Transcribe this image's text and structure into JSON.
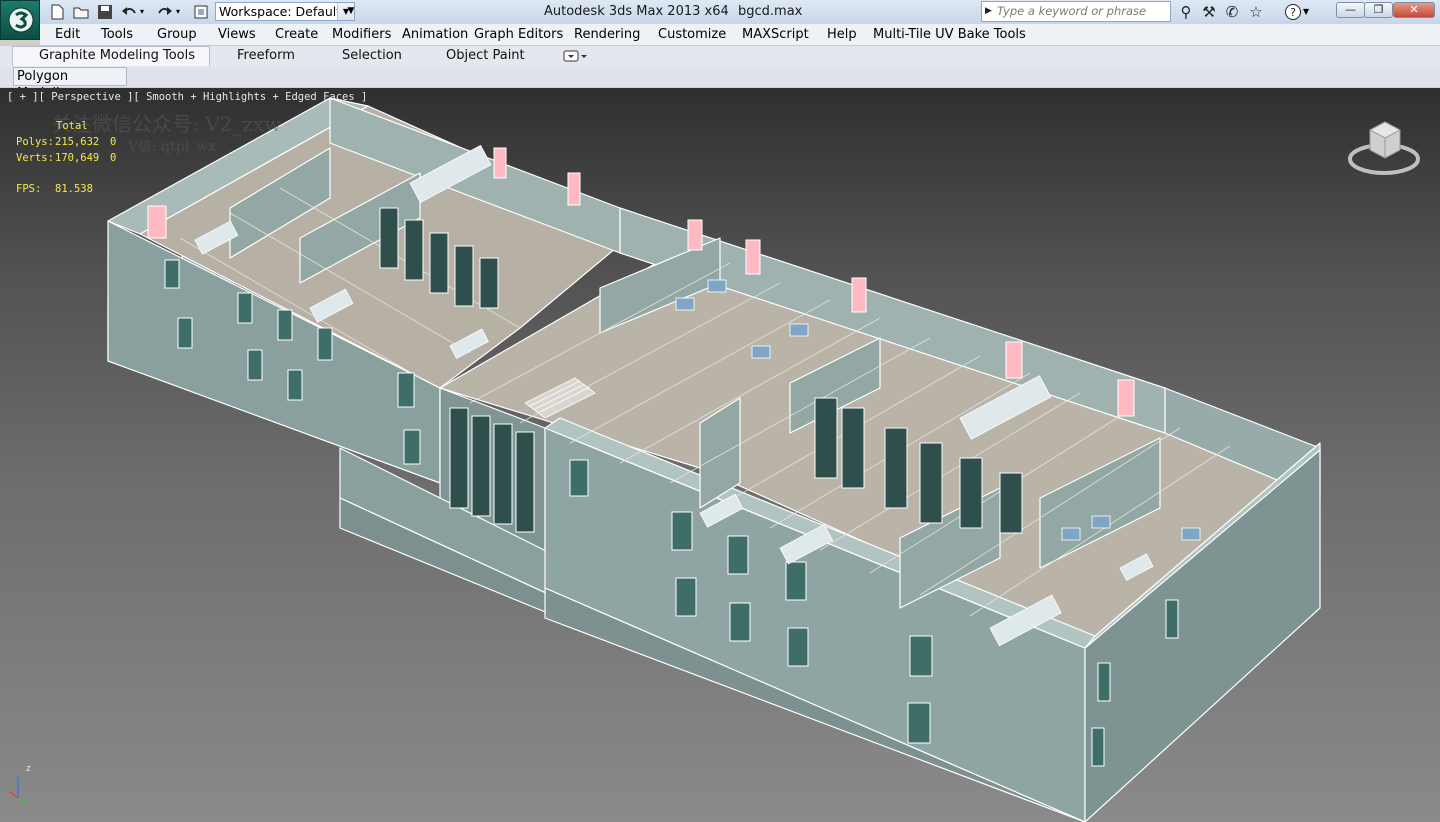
{
  "titlebar": {
    "workspace_label": "Workspace: Default",
    "app_title": "Autodesk 3ds Max  2013 x64",
    "file_name": "bgcd.max",
    "search_placeholder": "Type a keyword or phrase",
    "window_buttons": {
      "minimize": "—",
      "restore": "❐",
      "close": "✕"
    }
  },
  "menu": {
    "items": [
      "Edit",
      "Tools",
      "Group",
      "Views",
      "Create",
      "Modifiers",
      "Animation",
      "Graph Editors",
      "Rendering",
      "Customize",
      "MAXScript",
      "Help",
      "Multi-Tile UV Bake Tools"
    ]
  },
  "ribbon": {
    "tabs": [
      "Graphite Modeling Tools",
      "Freeform",
      "Selection",
      "Object Paint"
    ],
    "active_tab": "Graphite Modeling Tools",
    "panel_tab": "Polygon Modeling"
  },
  "viewport": {
    "label": "[ + ][ Perspective ][ Smooth + Highlights + Edged Faces ]",
    "stats": {
      "header": "Total",
      "polys_label": "Polys:",
      "polys_value": "215,632",
      "polys_sel": "0",
      "verts_label": "Verts:",
      "verts_value": "170,649",
      "verts_sel": "0",
      "fps_label": "FPS:",
      "fps_value": "81.538"
    },
    "watermark_1": "关注微信公众号: V2_zxw",
    "watermark_2": "V信: qtpl_wx",
    "axis_z": "z"
  },
  "colors": {
    "wall": "#8fa5a3",
    "wall_top": "#a9bdbb",
    "floor": "#b9b3a8",
    "window": "#3f6e68",
    "wire": "#ffffff",
    "stats_text": "#f6e94a",
    "viewport_border": "#f5e30e"
  }
}
